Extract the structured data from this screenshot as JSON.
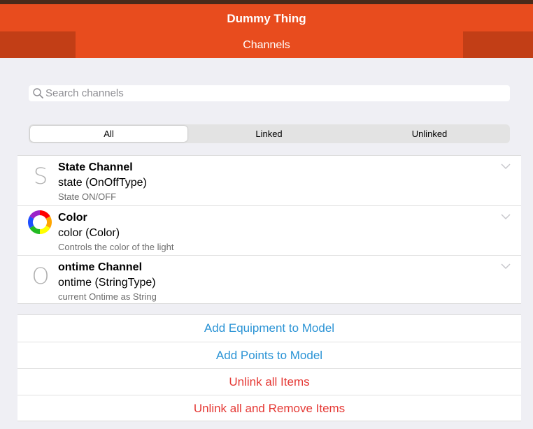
{
  "header": {
    "title": "Dummy Thing",
    "tab_label": "Channels"
  },
  "search": {
    "placeholder": "Search channels",
    "value": ""
  },
  "filter": {
    "options": [
      "All",
      "Linked",
      "Unlinked"
    ],
    "selected": "All"
  },
  "channels": [
    {
      "icon_letter": "S",
      "title": "State Channel",
      "subtitle": "state (OnOffType)",
      "description": "State ON/OFF"
    },
    {
      "icon": "color-wheel-icon",
      "title": "Color",
      "subtitle": "color (Color)",
      "description": "Controls the color of the light"
    },
    {
      "icon_letter": "O",
      "title": "ontime Channel",
      "subtitle": "ontime (StringType)",
      "description": "current Ontime as String"
    }
  ],
  "actions": [
    {
      "label": "Add Equipment to Model",
      "color": "#2a93d5"
    },
    {
      "label": "Add Points to Model",
      "color": "#2a93d5"
    },
    {
      "label": "Unlink all Items",
      "color": "#e53935"
    },
    {
      "label": "Unlink all and Remove Items",
      "color": "#e53935"
    }
  ],
  "colors": {
    "accent": "#e84c1e",
    "accent_dark": "#c23e16",
    "link_blue": "#2a93d5",
    "danger_red": "#e53935"
  }
}
